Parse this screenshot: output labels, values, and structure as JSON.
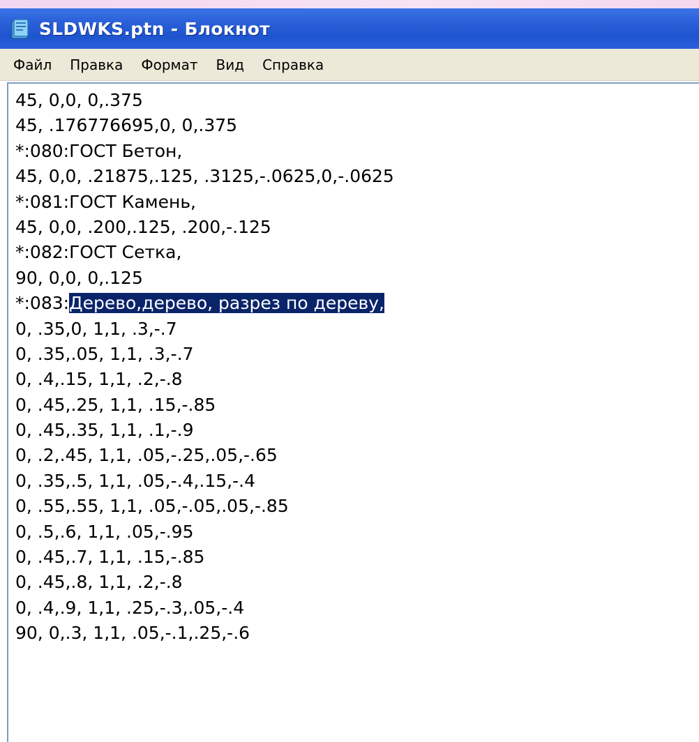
{
  "window": {
    "title": "SLDWKS.ptn - Блокнот",
    "icon": "notepad-icon",
    "colors": {
      "titlebar": "#2458d6",
      "menubar": "#ece9d8",
      "selection": "#0a246a",
      "border": "#7f9db9"
    }
  },
  "menu": {
    "items": [
      "Файл",
      "Правка",
      "Формат",
      "Вид",
      "Справка"
    ]
  },
  "editor": {
    "lines": [
      "45, 0,0, 0,.375",
      "45, .176776695,0, 0,.375",
      "*:080:ГОСТ Бетон,",
      "45, 0,0, .21875,.125, .3125,-.0625,0,-.0625",
      "*:081:ГОСТ Камень,",
      "45, 0,0, .200,.125, .200,-.125",
      "*:082:ГОСТ Сетка,",
      "90, 0,0, 0,.125",
      "*:083:Дерево,дерево, разрез по дереву,",
      "0, .35,0, 1,1, .3,-.7",
      "0, .35,.05, 1,1, .3,-.7",
      "0, .4,.15, 1,1, .2,-.8",
      "0, .45,.25, 1,1, .15,-.85",
      "0, .45,.35, 1,1, .1,-.9",
      "0, .2,.45, 1,1, .05,-.25,.05,-.65",
      "0, .35,.5, 1,1, .05,-.4,.15,-.4",
      "0, .55,.55, 1,1, .05,-.05,.05,-.85",
      "0, .5,.6, 1,1, .05,-.95",
      "0, .45,.7, 1,1, .15,-.85",
      "0, .45,.8, 1,1, .2,-.8",
      "0, .4,.9, 1,1, .25,-.3,.05,-.4",
      "90, 0,.3, 1,1, .05,-.1,.25,-.6"
    ],
    "selection": {
      "line_index": 8,
      "prefix": "*:083:",
      "selected_text": "Дерево,дерево, разрез по дереву,"
    }
  }
}
